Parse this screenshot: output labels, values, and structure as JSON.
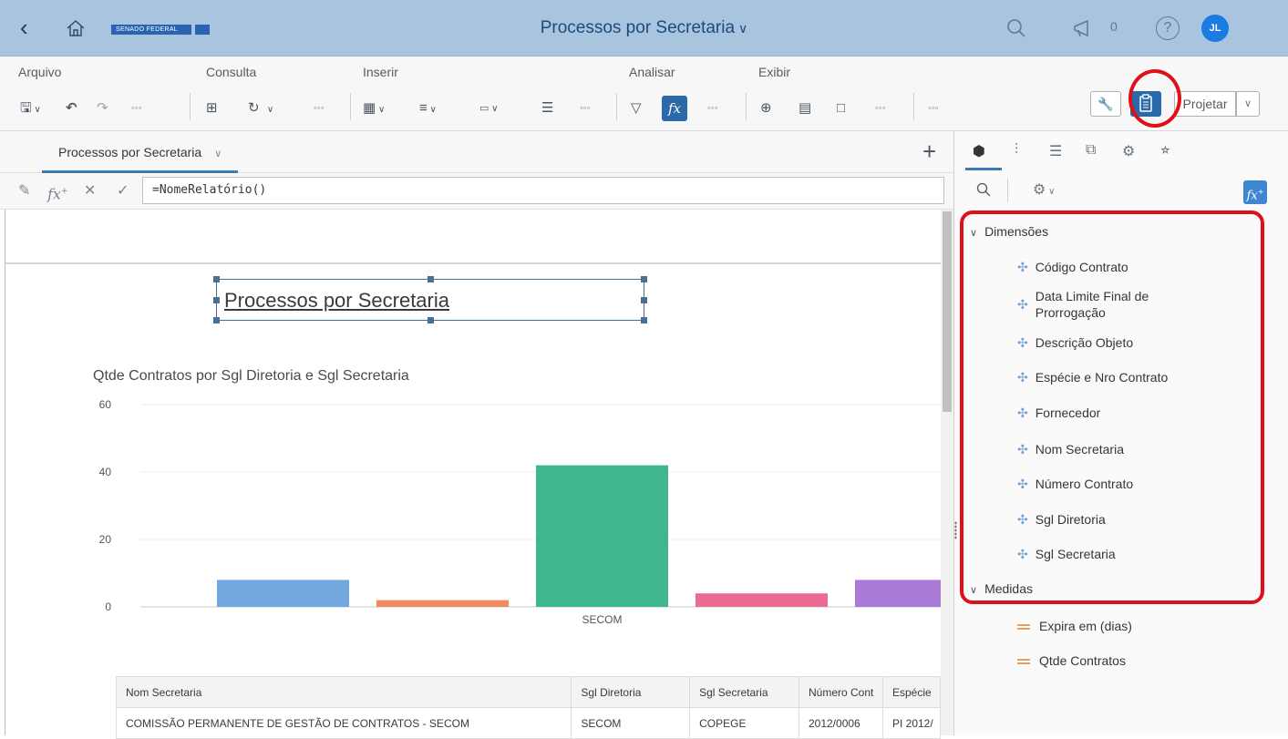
{
  "shell": {
    "title": "Processos por Secretaria",
    "logo_text": "SENADO FEDERAL",
    "notification_count": "0",
    "help": "?",
    "avatar_initials": "JL"
  },
  "toolbar": {
    "groups": {
      "arquivo": "Arquivo",
      "consulta": "Consulta",
      "inserir": "Inserir",
      "analisar": "Analisar",
      "exibir": "Exibir"
    },
    "projetar_label": "Projetar"
  },
  "tab": {
    "label": "Processos por Secretaria"
  },
  "formula": {
    "value": "=NomeRelatório()"
  },
  "report": {
    "title": "Processos por Secretaria",
    "chart_title": "Qtde Contratos por Sgl Diretoria e Sgl Secretaria"
  },
  "chart_data": {
    "type": "bar",
    "title": "Qtde Contratos por Sgl Diretoria e Sgl Secretaria",
    "categories": [
      "",
      "",
      "SECOM",
      "",
      ""
    ],
    "values": [
      8,
      2,
      42,
      4,
      8
    ],
    "colors": [
      "#73a7e0",
      "#ed8b5e",
      "#3fb68e",
      "#ed6b93",
      "#a97bd6"
    ],
    "ylim": [
      0,
      60
    ],
    "yticks": [
      0,
      20,
      40,
      60
    ],
    "xlabel": "",
    "ylabel": "",
    "grid": true
  },
  "table": {
    "headers": [
      "Nom Secretaria",
      "Sgl Diretoria",
      "Sgl Secretaria",
      "Número Cont",
      "Espécie"
    ],
    "rows": [
      [
        "COMISSÃO PERMANENTE DE GESTÃO DE CONTRATOS - SECOM",
        "SECOM",
        "COPEGE",
        "2012/0006",
        "PI 2012/"
      ]
    ]
  },
  "panel": {
    "groups": [
      {
        "label": "Dimensões",
        "items": [
          "Código Contrato",
          "Data Limite Final de Prorrogação",
          "Descrição Objeto",
          "Espécie e Nro Contrato",
          "Fornecedor",
          "Nom Secretaria",
          "Número Contrato",
          "Sgl Diretoria",
          "Sgl Secretaria"
        ]
      },
      {
        "label": "Medidas",
        "items": [
          "Expira em (dias)",
          "Qtde Contratos"
        ]
      }
    ],
    "data_limite_line1": "Data Limite Final de",
    "data_limite_line2": "Prorrogação"
  }
}
